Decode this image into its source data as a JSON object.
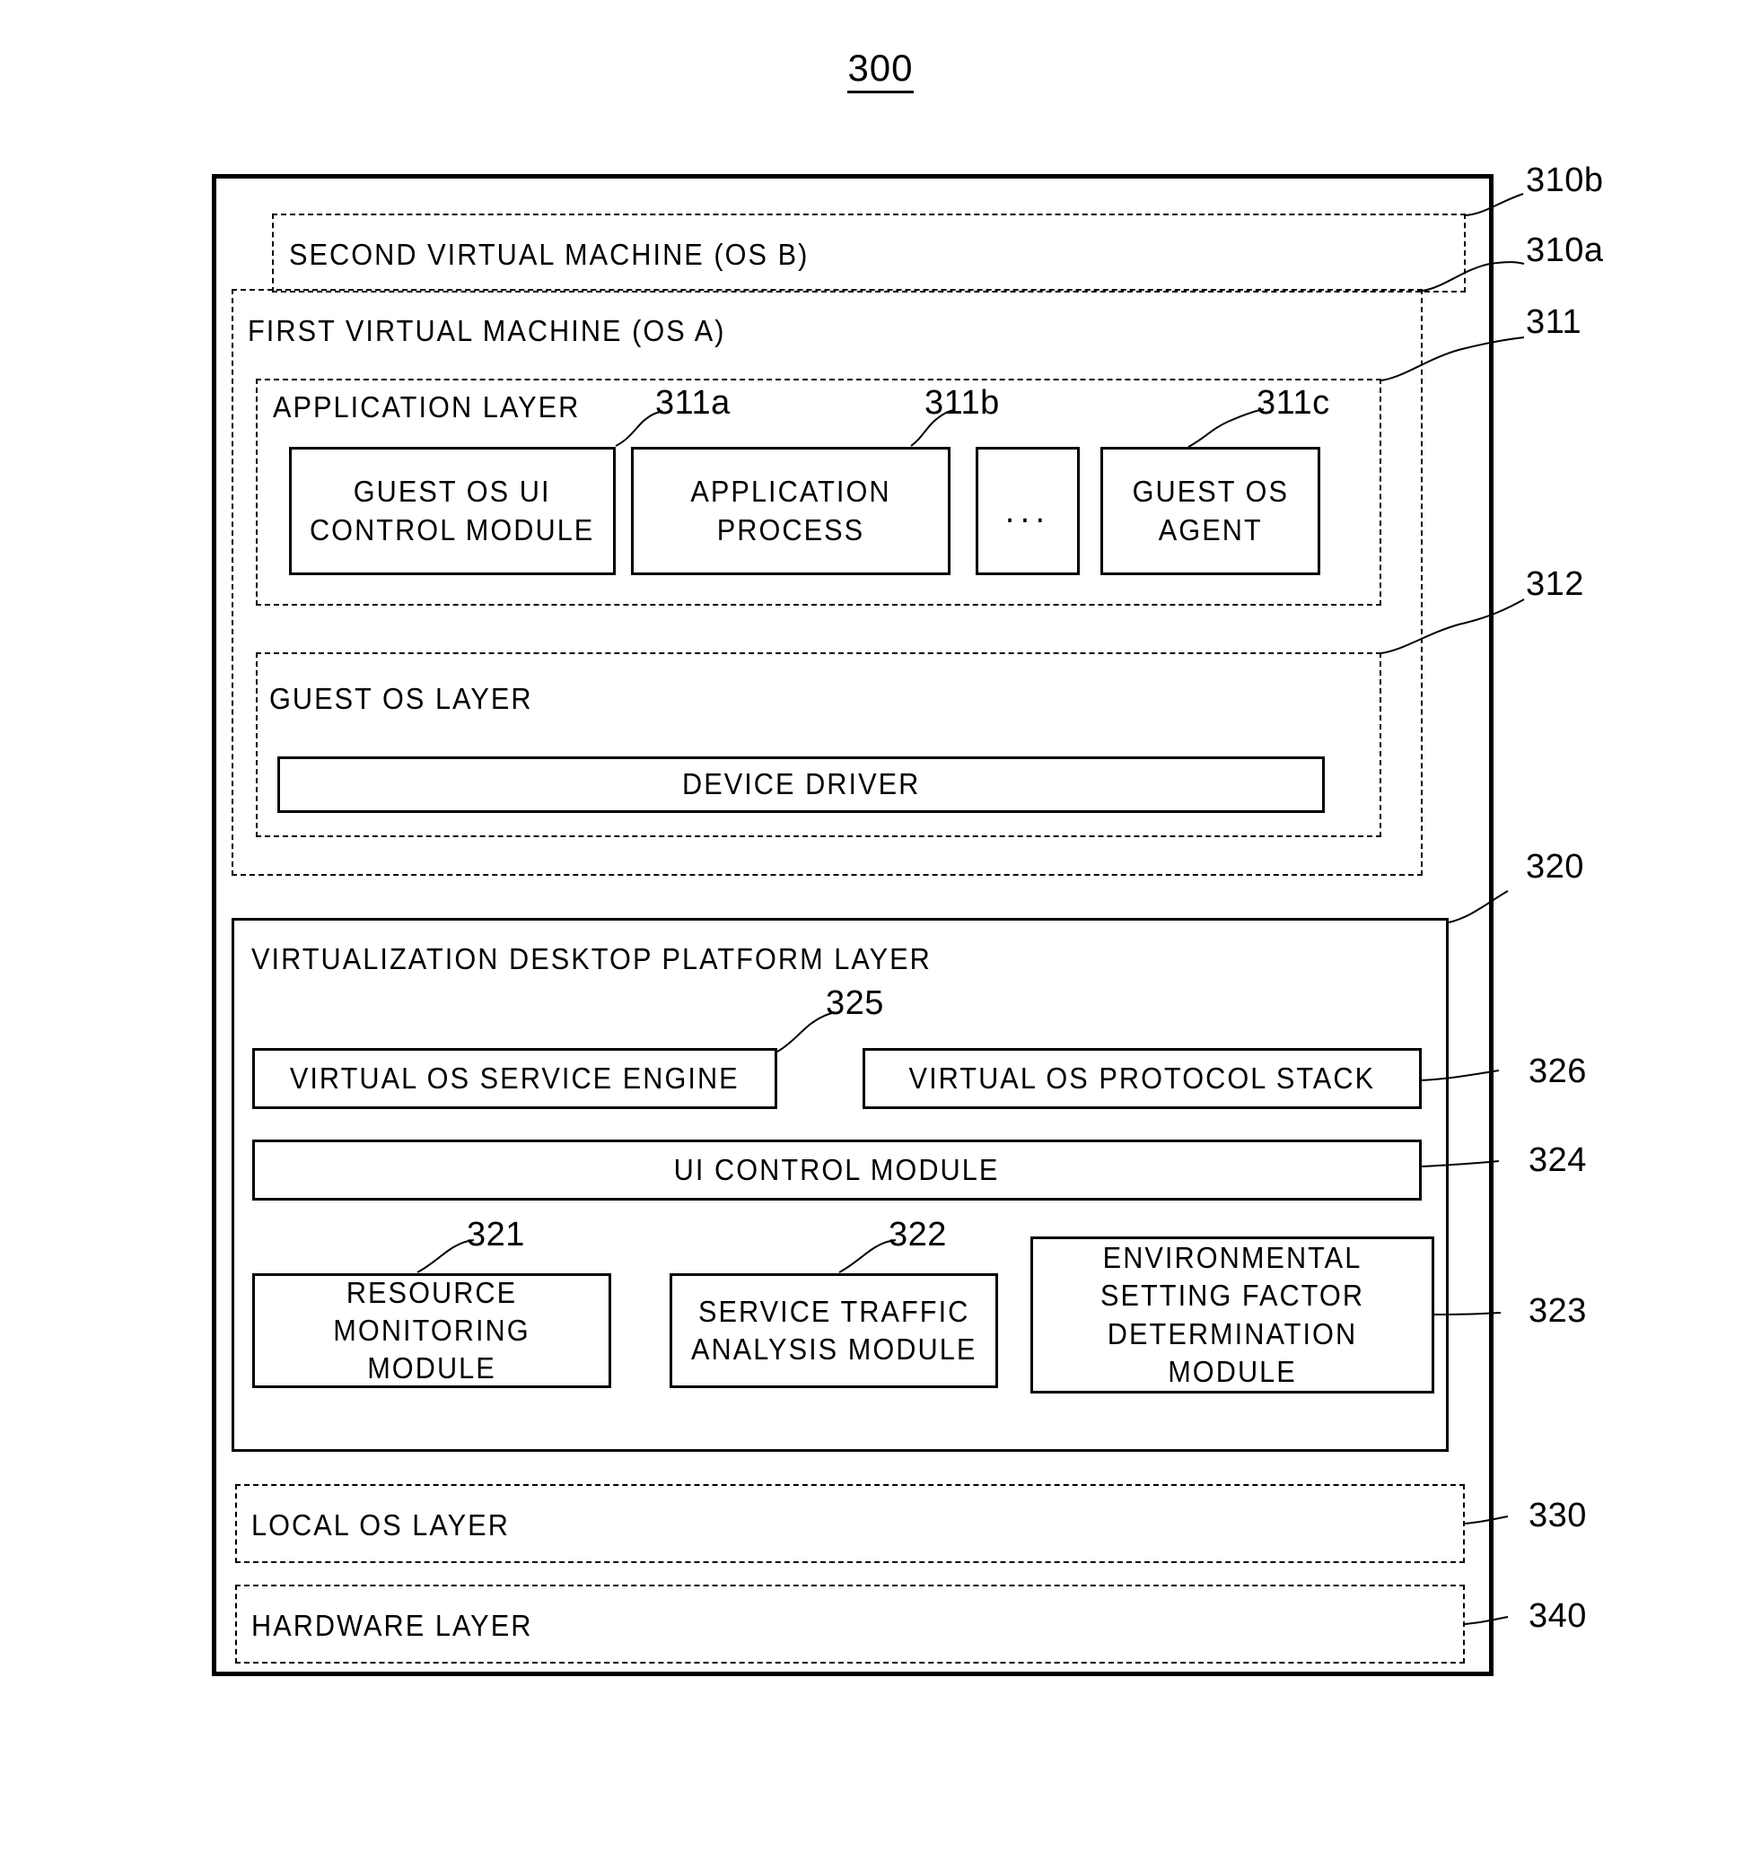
{
  "figure": {
    "number": "300"
  },
  "outer": {
    "name": "virtualization-system"
  },
  "virtual_machines": {
    "second": {
      "label": "SECOND VIRTUAL MACHINE (OS B)",
      "ref": "310b"
    },
    "first": {
      "label": "FIRST VIRTUAL MACHINE (OS A)",
      "ref": "310a"
    }
  },
  "application_layer": {
    "label": "APPLICATION LAYER",
    "ref": "311",
    "modules": [
      {
        "label": "GUEST OS UI\nCONTROL MODULE",
        "line1": "GUEST OS UI",
        "line2": "CONTROL MODULE",
        "ref": "311a"
      },
      {
        "label": "APPLICATION\nPROCESS",
        "line1": "APPLICATION",
        "line2": "PROCESS",
        "ref": "311b"
      },
      {
        "label": "...",
        "line1": "...",
        "line2": "",
        "ref": ""
      },
      {
        "label": "GUEST OS\nAGENT",
        "line1": "GUEST OS",
        "line2": "AGENT",
        "ref": "311c"
      }
    ]
  },
  "guest_os_layer": {
    "label": "GUEST OS LAYER",
    "ref": "312",
    "device_driver": "DEVICE DRIVER"
  },
  "platform_layer": {
    "label": "VIRTUALIZATION DESKTOP PLATFORM LAYER",
    "ref": "320",
    "service_engine": {
      "label": "VIRTUAL OS SERVICE ENGINE",
      "ref": "325"
    },
    "protocol_stack": {
      "label": "VIRTUAL OS PROTOCOL STACK",
      "ref": "326"
    },
    "ui_control_module": {
      "label": "UI CONTROL MODULE",
      "ref": "324"
    },
    "modules": [
      {
        "line1": "RESOURCE MONITORING",
        "line2": "MODULE",
        "line3": "",
        "ref": "321"
      },
      {
        "line1": "SERVICE TRAFFIC",
        "line2": "ANALYSIS MODULE",
        "line3": "",
        "ref": "322"
      },
      {
        "line1": "ENVIRONMENTAL",
        "line2": "SETTING FACTOR",
        "line3": "DETERMINATION MODULE",
        "ref": "323"
      }
    ]
  },
  "local_os_layer": {
    "label": "LOCAL OS LAYER",
    "ref": "330"
  },
  "hardware_layer": {
    "label": "HARDWARE LAYER",
    "ref": "340"
  },
  "colors": {
    "stroke": "#000000",
    "background": "#ffffff"
  }
}
